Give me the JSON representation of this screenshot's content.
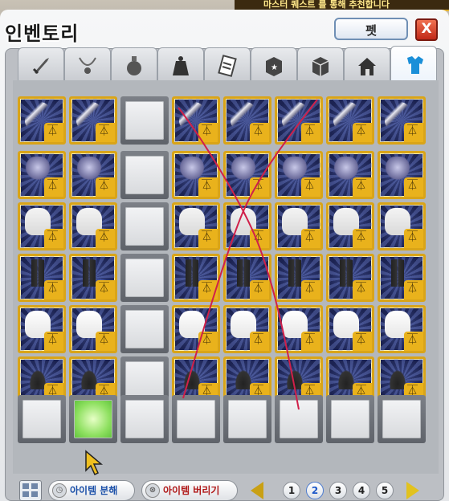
{
  "background": {
    "banner_text": "마스터 퀘스트 를 통해 추천합니다"
  },
  "window": {
    "title": "인벤토리",
    "pet_button": "펫",
    "close_button": "X"
  },
  "tabs": [
    {
      "name": "equip-tab",
      "icon": "sword-icon",
      "active": false
    },
    {
      "name": "use-tab",
      "icon": "necklace-icon",
      "active": false
    },
    {
      "name": "consume-tab",
      "icon": "potion-icon",
      "active": false
    },
    {
      "name": "etc-tab",
      "icon": "bag-icon",
      "active": false
    },
    {
      "name": "install-tab",
      "icon": "scroll-icon",
      "active": false
    },
    {
      "name": "cash-tab",
      "icon": "box-star-icon",
      "active": false
    },
    {
      "name": "cash2-tab",
      "icon": "box-icon",
      "active": false
    },
    {
      "name": "house-tab",
      "icon": "house-icon",
      "active": false
    },
    {
      "name": "cosmetic-tab",
      "icon": "clothes-icon",
      "active": true
    }
  ],
  "grid": {
    "columns": 8,
    "rows": [
      [
        "weapon",
        "weapon",
        "empty",
        "weapon",
        "weapon",
        "weapon",
        "weapon",
        "weapon"
      ],
      [
        "hair",
        "hair",
        "empty",
        "hair",
        "hair",
        "hair",
        "hair",
        "hair"
      ],
      [
        "top",
        "top",
        "empty",
        "top",
        "top",
        "top",
        "top",
        "top"
      ],
      [
        "bottom",
        "bottom",
        "empty",
        "bottom",
        "bottom",
        "bottom",
        "bottom",
        "bottom"
      ],
      [
        "glove",
        "glove",
        "empty",
        "glove",
        "glove",
        "glove",
        "glove",
        "glove"
      ],
      [
        "shoe",
        "shoe",
        "empty",
        "shoe",
        "shoe",
        "shoe",
        "shoe",
        "shoe"
      ],
      [
        "empty",
        "empty-selected",
        "empty",
        "empty",
        "empty",
        "empty",
        "empty",
        "empty"
      ]
    ]
  },
  "bottom": {
    "disassemble_label": "아이템 분해",
    "discard_label": "아이템 버리기",
    "pages": [
      "1",
      "2",
      "3",
      "4",
      "5"
    ],
    "active_page": "2"
  },
  "colors": {
    "accent_gold": "#d9a418",
    "slot_navy": "#1c2352",
    "annotation_red": "#d0204a",
    "active_page": "#1d58c8"
  }
}
